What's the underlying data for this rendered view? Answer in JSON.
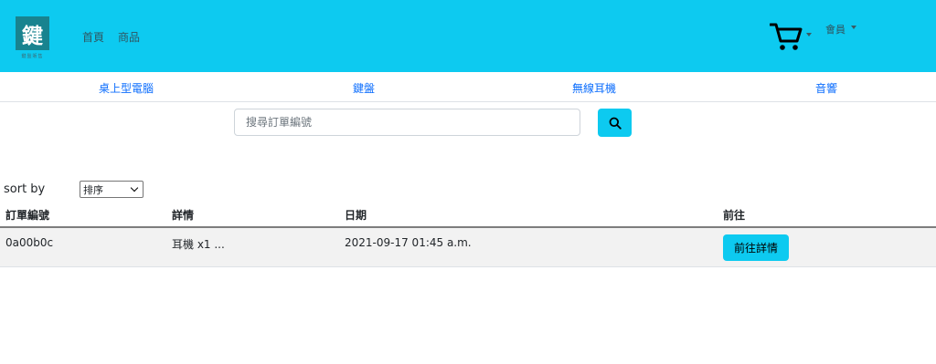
{
  "header": {
    "logo_char": "鍵",
    "logo_sub": "鍵盤販售",
    "nav": [
      "首頁",
      "商品"
    ],
    "member_label": "會員"
  },
  "categories": [
    "桌上型電腦",
    "鍵盤",
    "無線耳機",
    "音響"
  ],
  "search": {
    "placeholder": "搜尋訂單編號",
    "value": ""
  },
  "sort": {
    "label": "sort by",
    "selected": "排序"
  },
  "table": {
    "headers": [
      "訂單編號",
      "詳情",
      "日期",
      "前往"
    ],
    "rows": [
      {
        "order_id": "0a00b0c",
        "detail": "耳機 x1 ...",
        "date": "2021-09-17 01:45 a.m.",
        "action": "前往詳情"
      }
    ]
  },
  "colors": {
    "accent": "#0dcaf0",
    "link": "#0d6efd",
    "logo_bg": "#18838f",
    "row_bg": "#f2f2f2"
  }
}
